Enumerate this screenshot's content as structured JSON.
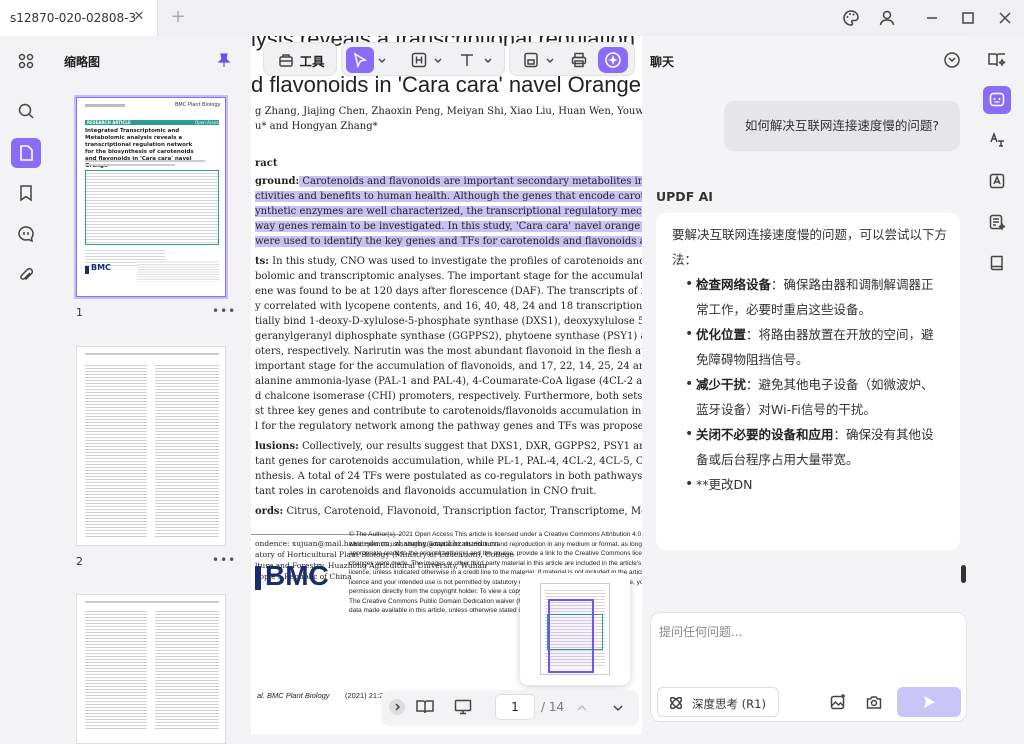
{
  "window": {
    "tab_title": "s12870-020-02808-3",
    "tab_close": "✕",
    "tab_add": "+"
  },
  "thumbnails": {
    "title": "缩略图",
    "pages": [
      {
        "number": "1"
      },
      {
        "number": "2"
      }
    ],
    "more": "•••",
    "page1": {
      "journal": "BMC Plant Biology",
      "section": "RESEARCH ARTICLE",
      "access": "Open Access",
      "title": "Integrated Transcriptomic and Metabolomic analysis reveals a transcriptional regulation network for the biosynthesis of carotenoids and flavonoids in 'Cara cara' navel Orange",
      "brand": "BMC"
    }
  },
  "toolbar": {
    "tools_label": "工具"
  },
  "document": {
    "title_line1": "lysis reveals a transcriptional regulation",
    "title_line2": "d flavonoids in 'Cara cara' navel Orange",
    "title_left_fragment": "ic ar",
    "title_right_fragment": "c",
    "authors_line1": "g Zhang, Jiajing Chen, Zhaoxin Peng, Meiyan Shi, Xiao Liu, Huan Wen, Youwu Jiang, Yunjiar",
    "authors_line2": "u* and Hongyan Zhang*",
    "abstract_heading": "ract",
    "background_label": "ground:",
    "background_lines": [
      " Carotenoids and flavonoids are important secondary metabolites in plants, which exert",
      "ctivities and benefits to human health. Although the genes that encode carotenogenesis and flav",
      "ynthetic enzymes are well characterized, the transcriptional regulatory mechanisms that are relate",
      "way genes remain to be investigated. In this study, 'Cara cara' navel orange (CNO) fruit at four de",
      "were used to identify the key genes and TFs for carotenoids and flavonoids accumulation."
    ],
    "results_label": "ts:",
    "results_lines": [
      " In this study, CNO was used to investigate the profiles of carotenoids and flavonoids by a",
      "bolomic and transcriptomic analyses. The important stage for the accumulation of the major car",
      "ene was found to be at 120 days after florescence (DAF). The transcripts of five carotenogenesis",
      "y correlated with lycopene contents, and 16, 40, 48, 24 and 18 transcription factors (TFs) were pr",
      "tially bind 1-deoxy-D-xylulose-5-phosphate synthase (DXS1), deoxyxylulose 5-phosphate reducto",
      "geranylgeranyl diphosphate synthase (GGPPS2), phytoene synthase (PSY1) and lycopene β-cycla",
      "oters, respectively. Narirutin was the most abundant flavonoid in the flesh at the early stages, 60",
      "important stage for the accumulation of flavonoids, and 17, 22, 14, 25, 24 and 16 TFs could pote",
      "alanine ammonia-lyase (PAL-1 and PAL-4), 4-Coumarate-CoA ligase (4CL-2 and 4CL-5), chalcone",
      "d chalcone isomerase (CHI) promoters, respectively. Furthermore, both sets of 15 candidate TFs n",
      "st three key genes and contribute to carotenoids/flavonoids accumulation in CNO fruit. Finally, a",
      "l for the regulatory network among the pathway genes and TFs was proposed."
    ],
    "conclusions_label": "lusions:",
    "conclusions_lines": [
      " Collectively, our results suggest that DXS1, DXR, GGPPS2, PSY1 and LCYB genes were the",
      "tant genes for carotenoids accumulation, while PL-1, PAL-4, 4CL-2, 4CL-5, CHS-1 and CHI for flav",
      "nthesis. A total of 24 TFs were postulated as co-regulators in both pathways directly, which migh",
      "tant roles in carotenoids and flavonoids accumulation in CNO fruit."
    ],
    "keywords_label": "ords:",
    "keywords_text": " Citrus, Carotenoid, Flavonoid, Transcription factor, Transcriptome, Metabolomics",
    "correspondence_lines": [
      "ondence: xujuan@mail.hzau.edu.cn; zhanghy@mail.hzau.edu.cn",
      "atory of Horticultural Plant Biology (Ministry of Education), College",
      "lture and Forestry, Huazhong Agricultural University, Wuhan",
      "eople's Republic of China"
    ],
    "brand": "BMC",
    "license_lines": [
      "© The Author(s). 2021 Open Access This article is licensed under a Creative Commons Attribution 4.0 Intern",
      "which permits use, sharing, adaptation, distribution and reproduction in any medium or format, as long as yo",
      "appropriate credit to the original author(s) and the source, provide a link to the Creative Commons licence, a",
      "changes were made. The images or other third party material in this article are included in the article's Crea",
      "licence, unless indicated otherwise in a credit line to the material. If material is not included in the article's C",
      "licence and your intended use is not permitted by statutory regulation or exceeds the permitted use, you wi",
      "permission directly from the copyright holder. To view a copy",
      "The Creative Commons Public Domain Dedication waiver (https",
      "data made available in this article, unless otherwise stated in a"
    ],
    "footer_left": "al. BMC Plant Biology",
    "footer_year": "(2021) 21:2"
  },
  "pagination": {
    "current_page": "1",
    "total": "/ 14"
  },
  "chat": {
    "title": "聊天",
    "user_message": "如何解决互联网连接速度慢的问题?",
    "ai_name": "UPDF AI",
    "ai_intro": "要解决互联网连接速度慢的问题，可以尝试以下方法：",
    "bullets": [
      {
        "bold": "检查网络设备",
        "text": "：确保路由器和调制解调器正常工作，必要时重启这些设备。"
      },
      {
        "bold": "优化位置",
        "text": "：将路由器放置在开放的空间，避免障碍物阻挡信号。"
      },
      {
        "bold": "减少干扰",
        "text": "：避免其他电子设备（如微波炉、蓝牙设备）对Wi-Fi信号的干扰。"
      },
      {
        "bold": "关闭不必要的设备和应用",
        "text": "：确保没有其他设备或后台程序占用大量带宽。"
      },
      {
        "bold": "",
        "text": "**更改DN"
      }
    ],
    "input_placeholder": "提问任何问题...",
    "deep_think_label": "深度思考 (R1)"
  },
  "colors": {
    "accent": "#8a6cf6",
    "highlight": "#c8c2f4",
    "selection": "#c9bcfb"
  },
  "icons": [
    "palette-icon",
    "user-icon",
    "minimize-icon",
    "maximize-icon",
    "close-icon",
    "grid-icon",
    "search-icon",
    "page-icon",
    "bookmark-icon",
    "comment-icon",
    "attachment-icon",
    "pin-icon",
    "tools-icon",
    "cursor-icon",
    "heading-icon",
    "text-icon",
    "save-icon",
    "print-icon",
    "ai-icon",
    "clock-icon",
    "book-icon",
    "ai-assistant-icon",
    "translate-icon",
    "ocr-icon",
    "summary-icon",
    "library-icon",
    "atom-icon",
    "image-icon",
    "camera-icon",
    "send-icon"
  ]
}
